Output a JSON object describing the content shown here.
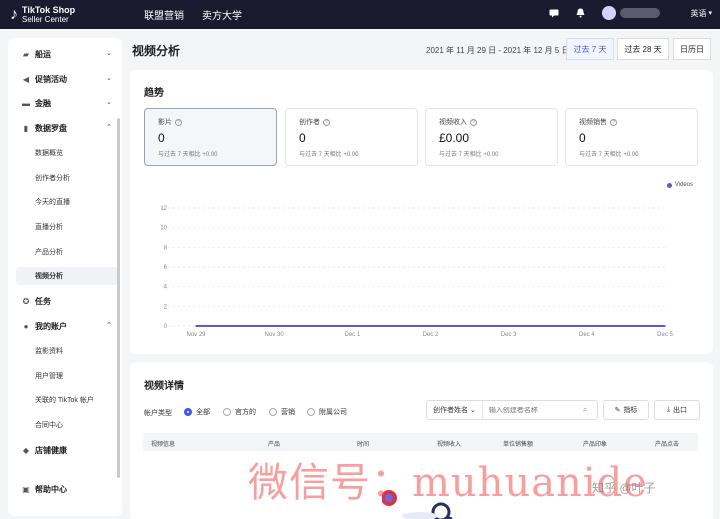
{
  "topbar": {
    "logo_line1": "TikTok Shop",
    "logo_line2": "Seller Center",
    "nav": [
      "联盟营销",
      "卖方大学"
    ],
    "language": "英语"
  },
  "sidebar": {
    "items": [
      {
        "label": "船运",
        "icon": "truck-icon"
      },
      {
        "label": "促销活动",
        "icon": "megaphone-icon"
      },
      {
        "label": "金融",
        "icon": "wallet-icon"
      },
      {
        "label": "数据罗盘",
        "icon": "chart-icon"
      },
      {
        "label": "任务",
        "icon": "medal-icon"
      },
      {
        "label": "我的账户",
        "icon": "user-icon"
      },
      {
        "label": "店铺健康",
        "icon": "shield-icon"
      },
      {
        "label": "帮助中心",
        "icon": "help-icon"
      }
    ],
    "data_subitems": [
      "数据概览",
      "创作者分析",
      "今天的直播",
      "直播分析",
      "产品分析",
      "视频分析"
    ],
    "account_subitems": [
      "监影资料",
      "用户管理",
      "关联的 TikTok 帐户",
      "合同中心"
    ]
  },
  "header": {
    "title": "视频分析",
    "date_range": "2021 年 11 月 29 日 - 2021 年 12 月 5 日",
    "ranges": [
      "过去 7 天",
      "过去 28 天",
      "日历日"
    ]
  },
  "trend": {
    "title": "趋势",
    "metrics": [
      {
        "label": "影片",
        "value": "0",
        "compare": "与过去 7 天相比 +0.00"
      },
      {
        "label": "创作者",
        "value": "0",
        "compare": "与过去 7 天相比 +0.00"
      },
      {
        "label": "视频收入",
        "value": "£0.00",
        "compare": "与过去 7 天相比 +0.00"
      },
      {
        "label": "视频销售",
        "value": "0",
        "compare": "与过去 7 天相比 +0.00"
      }
    ],
    "legend": "Videos",
    "series_color": "#6355d8"
  },
  "chart_data": {
    "type": "line",
    "categories": [
      "Nov 29",
      "Nov 30",
      "Dec 1",
      "Dec 2",
      "Dec 3",
      "Dec 4",
      "Dec 5"
    ],
    "series": [
      {
        "name": "Videos",
        "values": [
          0,
          0,
          0,
          0,
          0,
          0,
          0
        ]
      }
    ],
    "y_ticks": [
      0,
      2,
      4,
      6,
      8,
      10,
      12
    ],
    "ylim": [
      0,
      12
    ],
    "grid": true,
    "legend_position": "top-right"
  },
  "details": {
    "title": "视频详情",
    "filter_label": "帐户类型",
    "filters": [
      "全部",
      "官方的",
      "营销",
      "附属公司"
    ],
    "search_select": "创作者姓名",
    "search_placeholder": "输入创建者名称",
    "btn_metrics": "指标",
    "btn_export": "出口",
    "columns": [
      "视频信息",
      "产品",
      "时间",
      "视频收入",
      "单位销售额",
      "产品印象",
      "产品点击"
    ]
  },
  "watermark": "微信号：muhuanide",
  "zhihu": "知乎 @叶子"
}
